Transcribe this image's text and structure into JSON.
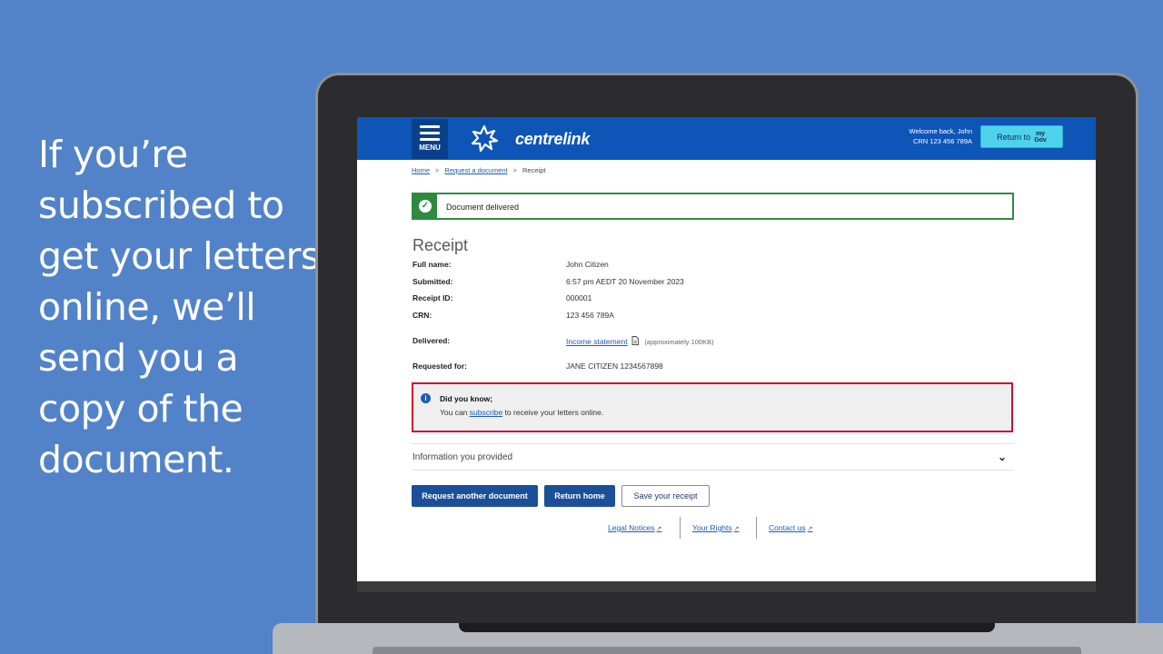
{
  "caption": "If you’re subscribed to get your letters online, we’ll send you a copy of the document.",
  "header": {
    "menu_label": "MENU",
    "brand_name": "centrelink",
    "welcome_line1": "Welcome back, John",
    "welcome_line2": "CRN 123 456 789A",
    "return_label": "Return to",
    "mygov_top": "my",
    "mygov_bottom": "Gov"
  },
  "breadcrumb": {
    "home": "Home",
    "request": "Request a document",
    "current": "Receipt",
    "sep": ">"
  },
  "alert": {
    "text": "Document delivered",
    "icon": "check-icon"
  },
  "receipt": {
    "title": "Receipt",
    "full_name_label": "Full name:",
    "full_name": "John Citizen",
    "submitted_label": "Submitted:",
    "submitted": "6:57 pm AEDT 20 November 2023",
    "receipt_id_label": "Receipt ID:",
    "receipt_id": "000001",
    "crn_label": "CRN:",
    "crn": "123 456 789A",
    "delivered_label": "Delivered:",
    "delivered_link": "Income statement",
    "delivered_size": "(approximately 100KB)",
    "requested_for_label": "Requested for:",
    "requested_for": "JANE CITIZEN 1234567898"
  },
  "info": {
    "title": "Did you know;",
    "body_prefix": "You can",
    "body_link": "subscribe",
    "body_suffix": "to receive your letters online."
  },
  "accordion": {
    "label": "Information you provided"
  },
  "buttons": {
    "request_another": "Request another document",
    "return_home": "Return home",
    "save_receipt": "Save your receipt"
  },
  "footer": {
    "legal": "Legal Notices",
    "rights": "Your Rights",
    "contact": "Contact us"
  },
  "colors": {
    "background": "#5283c8",
    "header_blue": "#0e55b8",
    "success_green": "#2e8b3e",
    "highlight_red": "#c8102e",
    "mygov_cyan": "#4fd2ec",
    "primary_button": "#1b4f98"
  }
}
